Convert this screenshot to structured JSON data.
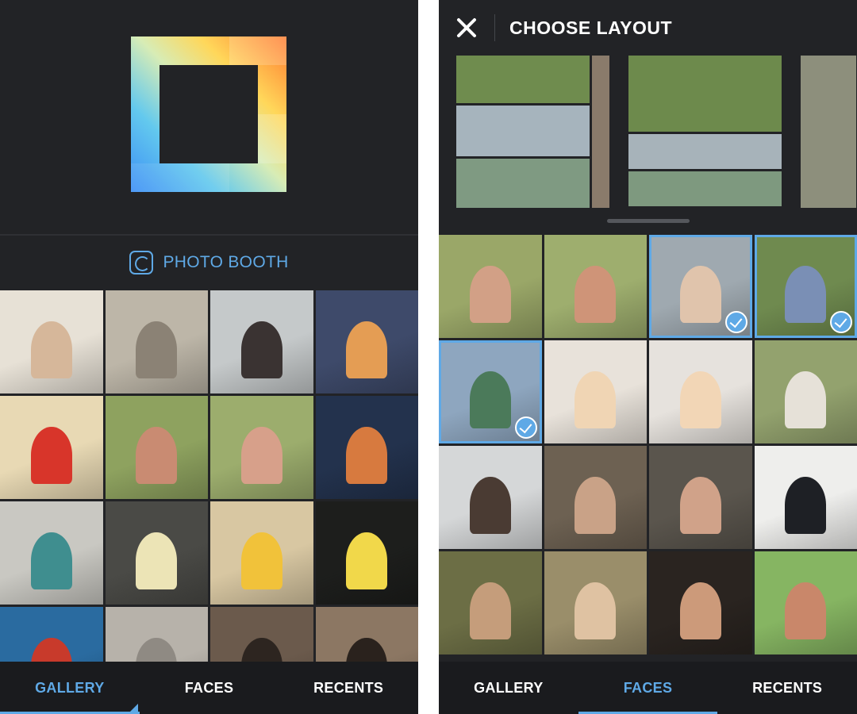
{
  "left_screen": {
    "photo_booth_label": "PHOTO BOOTH",
    "gallery_tiles": [
      {
        "name": "bulldog-photo",
        "bg": "#e7e1d6",
        "fig": "#d6b79a"
      },
      {
        "name": "cliff-photo",
        "bg": "#bdb6a8",
        "fig": "#8b8275"
      },
      {
        "name": "beach-sitting-photo",
        "bg": "#c5c9ca",
        "fig": "#3a3332"
      },
      {
        "name": "sunset-photo",
        "bg": "#3e4a6a",
        "fig": "#e49d54"
      },
      {
        "name": "balloons-photo",
        "bg": "#e8d9b4",
        "fig": "#d8352a"
      },
      {
        "name": "selfie-woman-photo",
        "bg": "#8ea25f",
        "fig": "#c98b72"
      },
      {
        "name": "selfie-pair-photo",
        "bg": "#9cad6d",
        "fig": "#d7a08a"
      },
      {
        "name": "palm-sunset-photo",
        "bg": "#23324d",
        "fig": "#d77a3f"
      },
      {
        "name": "house-kid-photo",
        "bg": "#c9c8c2",
        "fig": "#3f8e8f"
      },
      {
        "name": "cupcakes-photo",
        "bg": "#4a4a46",
        "fig": "#ece4b6"
      },
      {
        "name": "flowers-photo",
        "bg": "#d8c7a2",
        "fig": "#f1c23a"
      },
      {
        "name": "bike-leaves-photo",
        "bg": "#1d1e1c",
        "fig": "#f1d84a"
      },
      {
        "name": "coffee-photo",
        "bg": "#2a6ba0",
        "fig": "#c83a2b"
      },
      {
        "name": "sidewalk-photo",
        "bg": "#b7b2aa",
        "fig": "#8f8a83"
      },
      {
        "name": "puppy-photo",
        "bg": "#6b5a4c",
        "fig": "#2d2520"
      },
      {
        "name": "puppy2-photo",
        "bg": "#8c7763",
        "fig": "#2a221d"
      }
    ],
    "tabs": [
      {
        "label": "GALLERY",
        "active": true
      },
      {
        "label": "FACES",
        "active": false
      },
      {
        "label": "RECENTS",
        "active": false
      }
    ]
  },
  "right_screen": {
    "title": "CHOOSE LAYOUT",
    "close_icon": "close-icon",
    "layout_previews": [
      {
        "name": "layout-option-1",
        "cells": 3
      },
      {
        "name": "layout-option-2",
        "cells": 3
      },
      {
        "name": "layout-option-3",
        "cells": 1
      }
    ],
    "face_tiles": [
      {
        "name": "selfie-pair-face",
        "bg": "#9aa768",
        "fig": "#d2a086",
        "selected": false
      },
      {
        "name": "selfie-woman-face",
        "bg": "#9eae6e",
        "fig": "#cf9478",
        "selected": false
      },
      {
        "name": "couple-face",
        "bg": "#9fa9b0",
        "fig": "#e0c4ac",
        "selected": true
      },
      {
        "name": "lying-grass-face",
        "bg": "#6f8a4f",
        "fig": "#7a8fb5",
        "selected": true
      },
      {
        "name": "selfie-sky-face",
        "bg": "#8ea6bf",
        "fig": "#4b7a5a",
        "selected": true
      },
      {
        "name": "beach-woman-face",
        "bg": "#e8e2da",
        "fig": "#f0d5b4",
        "selected": false
      },
      {
        "name": "beach-woman2-face",
        "bg": "#e6e2dd",
        "fig": "#f2d6b6",
        "selected": false
      },
      {
        "name": "sitting-woman-face",
        "bg": "#93a26e",
        "fig": "#e6e1d8",
        "selected": false
      },
      {
        "name": "sunglasses-face",
        "bg": "#d5d7d8",
        "fig": "#4a3b33",
        "selected": false
      },
      {
        "name": "glasses-pair-face",
        "bg": "#6d6152",
        "fig": "#c9a287",
        "selected": false
      },
      {
        "name": "surprised-pair-face",
        "bg": "#5a554d",
        "fig": "#d0a289",
        "selected": false
      },
      {
        "name": "man-glasses-face",
        "bg": "#eeeeec",
        "fig": "#1e2025",
        "selected": false
      },
      {
        "name": "phone-girl-face",
        "bg": "#6c6e45",
        "fig": "#c59d7b",
        "selected": false
      },
      {
        "name": "laughing-woman-face",
        "bg": "#9a8e6a",
        "fig": "#dfc2a2",
        "selected": false
      },
      {
        "name": "group-night-face",
        "bg": "#2a2420",
        "fig": "#cc9a7a",
        "selected": false
      },
      {
        "name": "green-wall-face",
        "bg": "#86b562",
        "fig": "#c9876a",
        "selected": false
      }
    ],
    "tabs": [
      {
        "label": "GALLERY",
        "active": false
      },
      {
        "label": "FACES",
        "active": true
      },
      {
        "label": "RECENTS",
        "active": false
      }
    ]
  },
  "colors": {
    "accent": "#5fa9e6",
    "background": "#222326",
    "tabbar": "#1a1b1e"
  }
}
